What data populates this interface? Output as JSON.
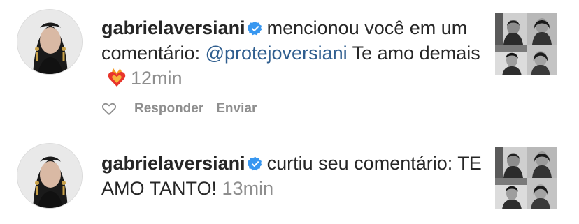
{
  "notifications": [
    {
      "username": "gabrielaversiani",
      "action_text": "mencionou você em um comentário:",
      "mention": "@protejoversiani",
      "comment_text": "Te amo demais",
      "emoji_icon": "heart-on-fire-icon",
      "time": "12min",
      "actions": {
        "reply_label": "Responder",
        "send_label": "Enviar"
      }
    },
    {
      "username": "gabrielaversiani",
      "action_text": "curtiu seu comentário:",
      "comment_text": "TE AMO TANTO!",
      "time": "13min"
    }
  ],
  "colors": {
    "text": "#262626",
    "secondary": "#8e8e8e",
    "mention": "#2f5e8f",
    "verified": "#3897f0"
  }
}
